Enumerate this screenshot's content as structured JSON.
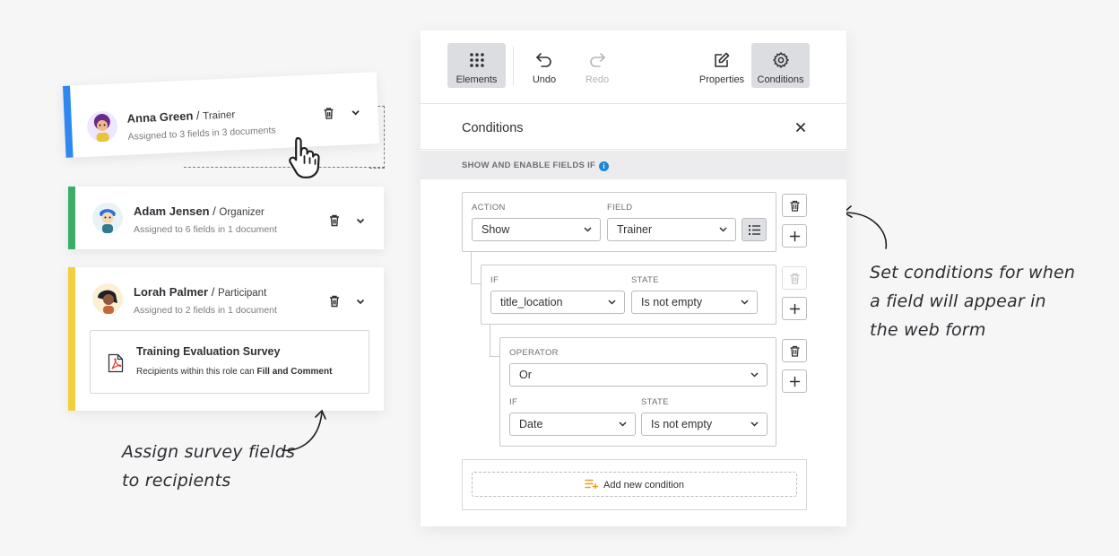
{
  "roles": [
    {
      "name": "Anna Green",
      "separator": " / ",
      "role": "Trainer",
      "summary": "Assigned to 3 fields in 3 documents",
      "bar_color": "#2f87f0"
    },
    {
      "name": "Adam Jensen",
      "separator": " / ",
      "role": "Organizer",
      "summary": "Assigned to 6 fields in 1 document",
      "bar_color": "#3dae6a"
    },
    {
      "name": "Lorah Palmer",
      "separator": " / ",
      "role": "Participant",
      "summary": "Assigned to 2 fields in 1 document",
      "bar_color": "#f2cf3c"
    }
  ],
  "document": {
    "title": "Training Evaluation Survey",
    "subtitle_prefix": "Recipients within this role can ",
    "subtitle_bold": "Fill and Comment"
  },
  "notes": {
    "left_line1": "Assign survey fields",
    "left_line2": "to recipients",
    "right_line1": "Set conditions for when",
    "right_line2": "a field will appear in",
    "right_line3": "the web form"
  },
  "toolbar": {
    "elements": "Elements",
    "undo": "Undo",
    "redo": "Redo",
    "properties": "Properties",
    "conditions": "Conditions"
  },
  "conditions_panel": {
    "title": "Conditions",
    "section_label": "SHOW AND ENABLE FIELDS IF",
    "action_label": "ACTION",
    "action_value": "Show",
    "field_label": "FIELD",
    "field_value": "Trainer",
    "if_label": "IF",
    "if_value": "title_location",
    "state_label": "STATE",
    "state_value": "Is not empty",
    "operator_label": "OPERATOR",
    "operator_value": "Or",
    "if2_label": "IF",
    "if2_value": "Date",
    "state2_label": "STATE",
    "state2_value": "Is not empty",
    "add_condition": "Add new condition"
  },
  "colors": {
    "accent_blue": "#1a87d8",
    "add_icon_orange": "#f29a1f"
  }
}
